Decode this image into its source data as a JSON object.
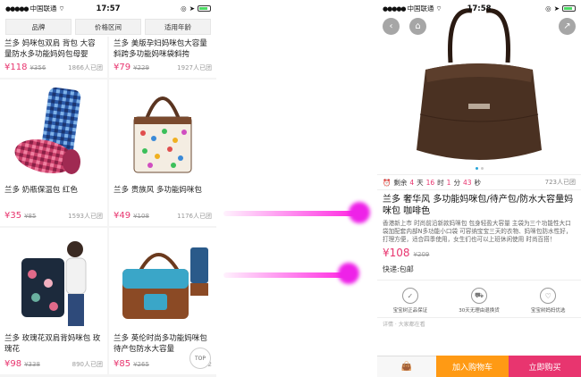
{
  "left": {
    "status": {
      "carrier": "中国联通",
      "time": "17:57"
    },
    "filters": [
      "品牌",
      "价格区间",
      "适用年龄"
    ],
    "products": [
      {
        "title": "兰多 妈咪包双肩 背包 大容量防水多功能妈妈包母婴",
        "price": "¥118",
        "old": "¥356",
        "sold": "1866人已团"
      },
      {
        "title": "兰多 美版孕妇妈咪包大容量斜跨多功能妈咪袋斜挎",
        "price": "¥79",
        "old": "¥229",
        "sold": "1927人已团"
      },
      {
        "title": "兰多 奶瓶保温包 红色",
        "price": "¥35",
        "old": "¥85",
        "sold": "1593人已团"
      },
      {
        "title": "兰多 贵族风 多功能妈咪包",
        "price": "¥49",
        "old": "¥108",
        "sold": "1176人已团"
      },
      {
        "title": "兰多 玫瑰花双肩背妈咪包 玫瑰花",
        "price": "¥98",
        "old": "¥338",
        "sold": "890人已团"
      },
      {
        "title": "兰多 英伦时尚多功能妈咪包待产包防水大容量",
        "price": "¥85",
        "old": "¥265",
        "sold": "1102"
      }
    ],
    "top_label": "TOP"
  },
  "right": {
    "status": {
      "carrier": "中国联通",
      "time": "17:58"
    },
    "countdown": {
      "label": "剩余",
      "d": "4",
      "d_unit": "天",
      "h": "16",
      "h_unit": "时",
      "m": "1",
      "m_unit": "分",
      "s": "43",
      "s_unit": "秒",
      "sold": "723人已团"
    },
    "title": "兰多 奢华风 多功能妈咪包/待产包/防水大容量妈咪包 咖啡色",
    "desc": "香港新上市 时尚前沿新款妈咪包 包身轻盈大容量 主袋为三个功能性大口袋加配套内部N多功能小口袋 可容纳宝宝三天的衣物、妈咪包防水性好，打理方便，适合四季使用，女生们也可以上班休闲使用 时尚百搭！",
    "price": "¥108",
    "old": "¥209",
    "shipping": "快递:包邮",
    "guarantees": [
      "宝宝树正品保证",
      "30天无理由退换货",
      "宝宝树妈妈优选"
    ],
    "more": "详情 · 大家都在看",
    "add_cart": "加入购物车",
    "buy_now": "立即购买"
  },
  "colors": {
    "accent": "#e8356f",
    "orange": "#ff9a14",
    "highlight": "#ee22e8"
  }
}
